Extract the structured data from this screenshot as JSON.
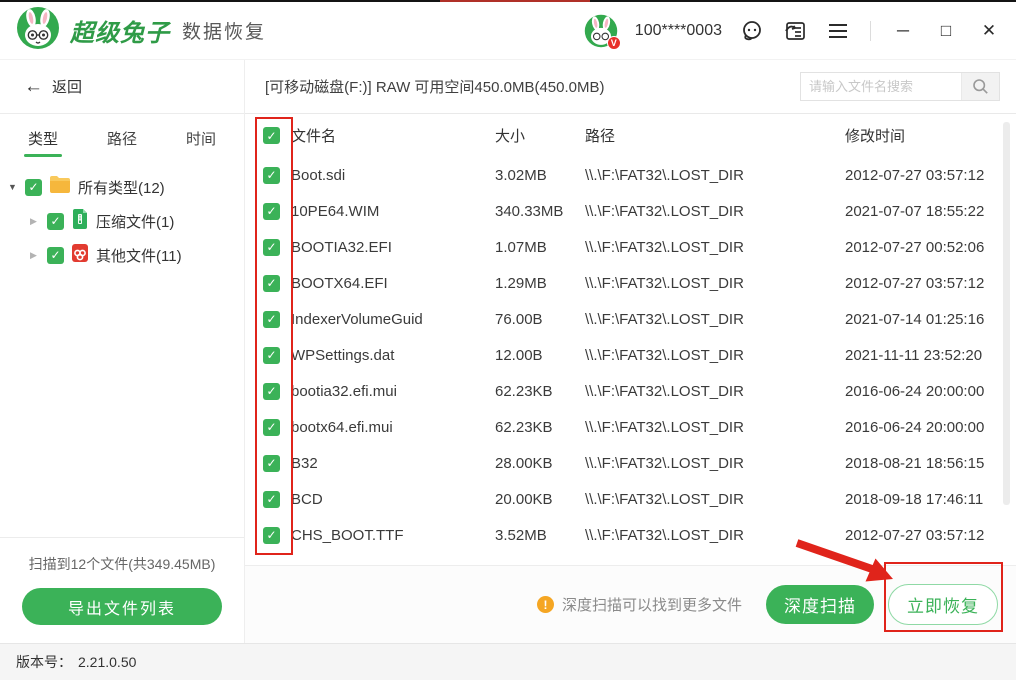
{
  "colors": {
    "accent_green": "#3bb258",
    "accent_dark_green": "#2f9b47",
    "annotation_red": "#e0241b",
    "warning_orange": "#f5a623"
  },
  "header": {
    "brand": "超级兔子",
    "brand_suffix": "数据恢复",
    "account": "100****0003",
    "icons": [
      "rabbit-logo",
      "avatar",
      "support-headset",
      "feedback",
      "menu",
      "minimize",
      "maximize",
      "close"
    ],
    "minimize_glyph": "─",
    "maximize_glyph": "□",
    "close_glyph": "✕"
  },
  "toolbar": {
    "disk_info": "[可移动磁盘(F:)] RAW 可用空间450.0MB(450.0MB)",
    "search_placeholder": "请输入文件名搜索"
  },
  "sidebar": {
    "back_label": "返回",
    "back_glyph": "←",
    "tabs": [
      {
        "label": "类型",
        "active": true
      },
      {
        "label": "路径",
        "active": false
      },
      {
        "label": "时间",
        "active": false
      }
    ],
    "tree": [
      {
        "label": "所有类型(12)",
        "icon": "folder",
        "expanded": true,
        "checked": true
      },
      {
        "label": "压缩文件(1)",
        "icon": "archive-file",
        "expanded": false,
        "checked": true
      },
      {
        "label": "其他文件(11)",
        "icon": "other-file",
        "expanded": false,
        "checked": true
      }
    ],
    "scan_summary": "扫描到12个文件(共349.45MB)",
    "export_button": "导出文件列表"
  },
  "table": {
    "columns": [
      "文件名",
      "大小",
      "路径",
      "修改时间"
    ],
    "rows": [
      {
        "name": "Boot.sdi",
        "size": "3.02MB",
        "path": "\\\\.\\F:\\FAT32\\.LOST_DIR",
        "time": "2012-07-27 03:57:12"
      },
      {
        "name": "10PE64.WIM",
        "size": "340.33MB",
        "path": "\\\\.\\F:\\FAT32\\.LOST_DIR",
        "time": "2021-07-07 18:55:22"
      },
      {
        "name": "BOOTIA32.EFI",
        "size": "1.07MB",
        "path": "\\\\.\\F:\\FAT32\\.LOST_DIR",
        "time": "2012-07-27 00:52:06"
      },
      {
        "name": "BOOTX64.EFI",
        "size": "1.29MB",
        "path": "\\\\.\\F:\\FAT32\\.LOST_DIR",
        "time": "2012-07-27 03:57:12"
      },
      {
        "name": "IndexerVolumeGuid",
        "size": "76.00B",
        "path": "\\\\.\\F:\\FAT32\\.LOST_DIR",
        "time": "2021-07-14 01:25:16"
      },
      {
        "name": "WPSettings.dat",
        "size": "12.00B",
        "path": "\\\\.\\F:\\FAT32\\.LOST_DIR",
        "time": "2021-11-11 23:52:20"
      },
      {
        "name": "bootia32.efi.mui",
        "size": "62.23KB",
        "path": "\\\\.\\F:\\FAT32\\.LOST_DIR",
        "time": "2016-06-24 20:00:00"
      },
      {
        "name": "bootx64.efi.mui",
        "size": "62.23KB",
        "path": "\\\\.\\F:\\FAT32\\.LOST_DIR",
        "time": "2016-06-24 20:00:00"
      },
      {
        "name": "B32",
        "size": "28.00KB",
        "path": "\\\\.\\F:\\FAT32\\.LOST_DIR",
        "time": "2018-08-21 18:56:15"
      },
      {
        "name": "BCD",
        "size": "20.00KB",
        "path": "\\\\.\\F:\\FAT32\\.LOST_DIR",
        "time": "2018-09-18 17:46:11"
      },
      {
        "name": "CHS_BOOT.TTF",
        "size": "3.52MB",
        "path": "\\\\.\\F:\\FAT32\\.LOST_DIR",
        "time": "2012-07-27 03:57:12"
      }
    ]
  },
  "action_bar": {
    "hint": "深度扫描可以找到更多文件",
    "warning_glyph": "!",
    "deep_scan_button": "深度扫描",
    "recover_button": "立即恢复"
  },
  "footer_bar": {
    "version_label": "版本号：",
    "version_value": "2.21.0.50"
  },
  "misc": {
    "check_glyph": "✓",
    "expand_glyph": "▼",
    "collapse_glyph": "▶"
  }
}
